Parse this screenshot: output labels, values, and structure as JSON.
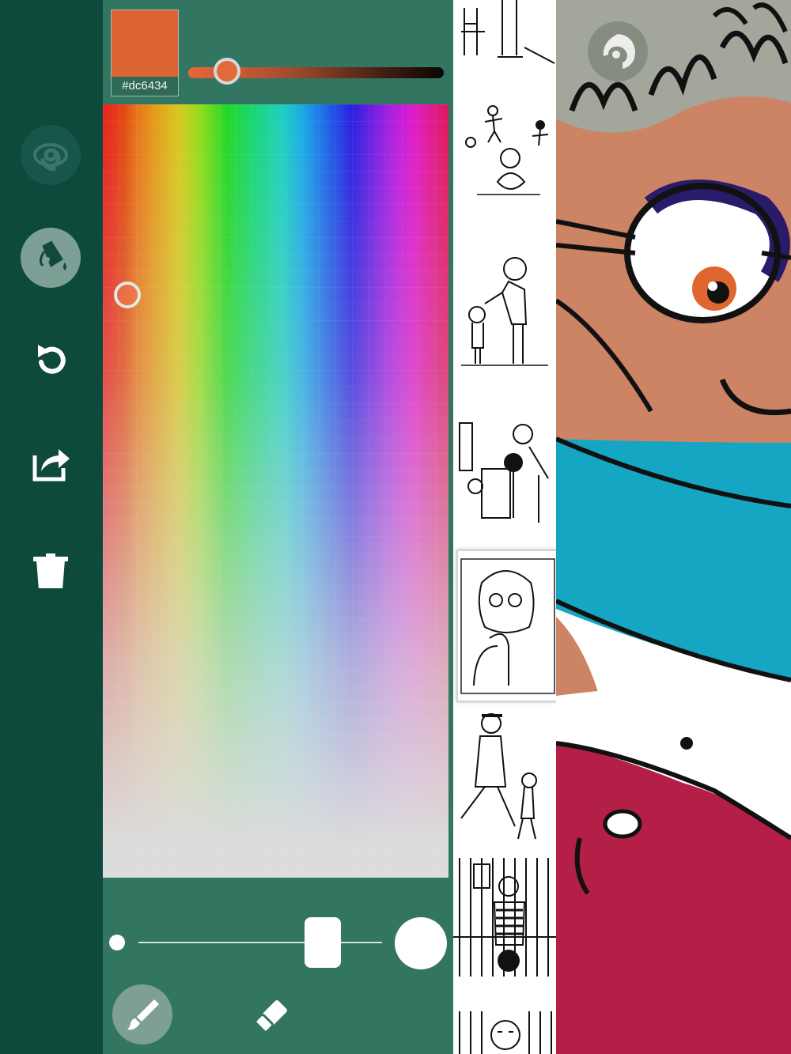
{
  "sidebar": {
    "buttons": [
      {
        "icon": "spiral-icon",
        "label": "stroke mode"
      },
      {
        "icon": "paint-bucket-icon",
        "label": "fill"
      },
      {
        "icon": "undo-icon",
        "label": "undo"
      },
      {
        "icon": "share-icon",
        "label": "share"
      },
      {
        "icon": "trash-icon",
        "label": "delete"
      }
    ]
  },
  "color_picker": {
    "selected_hex": "#dc6434",
    "selected_color": "#dc6434",
    "shade_level": 0.15
  },
  "brush": {
    "size_level": 0.75,
    "tools": [
      {
        "icon": "brush-icon",
        "selected": true
      },
      {
        "icon": "eraser-icon",
        "selected": false
      }
    ]
  },
  "gallery": {
    "items": [
      "page-1",
      "page-2",
      "page-3",
      "page-4",
      "page-5",
      "page-6",
      "page-7",
      "page-8"
    ],
    "active_index": 4
  },
  "canvas": {
    "overlay_icon": "face-silhouette-icon",
    "colors": {
      "hair": "#a3a69a",
      "skin": "#cd8465",
      "mask": "#15a6c4",
      "lips": "#b41f47",
      "iris": "#e0662f",
      "glasses": "#2a1a6a"
    }
  }
}
